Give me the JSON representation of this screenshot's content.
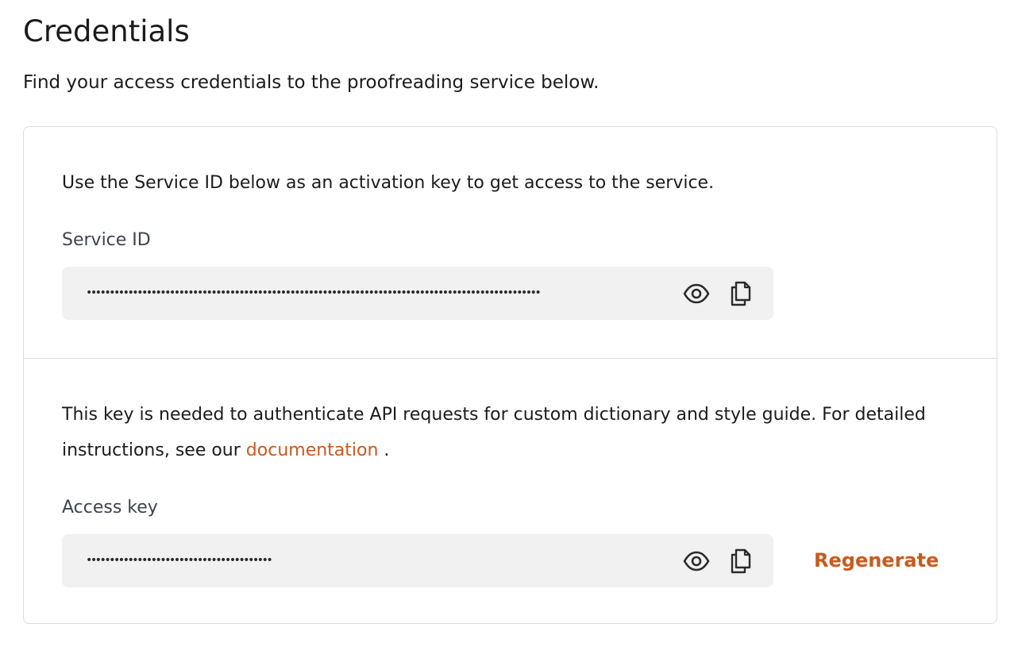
{
  "page": {
    "title": "Credentials",
    "subtitle": "Find your access credentials to the proofreading service below."
  },
  "service_section": {
    "description": "Use the Service ID below as an activation key to get access to the service.",
    "label": "Service ID",
    "masked_value": "••••••••••••••••••••••••••••••••••••••••••••••••••••••••••••••••••••••••••••••••••••••••••••••••••",
    "icons": [
      "eye-icon",
      "copy-icon"
    ]
  },
  "access_section": {
    "description_prefix": "This key is needed to authenticate API requests for custom dictionary and style guide. For detailed instructions, see our ",
    "link_text": "documentation",
    "description_suffix": " .",
    "label": "Access key",
    "masked_value": "••••••••••••••••••••••••••••••••••••••••",
    "regenerate_label": "Regenerate",
    "icons": [
      "eye-icon",
      "copy-icon"
    ]
  },
  "colors": {
    "accent": "#c85a1e",
    "field_bg": "#f1f1f1",
    "border": "#dcdcdc",
    "label": "#3c4250"
  }
}
